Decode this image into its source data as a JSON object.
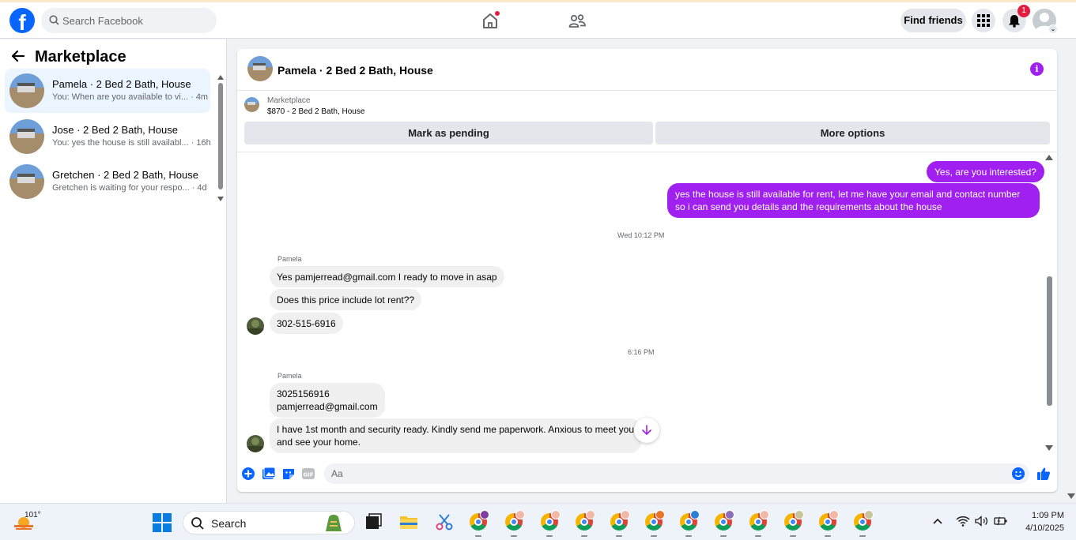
{
  "topbar": {
    "logo": "f",
    "search_placeholder": "Search Facebook",
    "find_friends": "Find friends",
    "notification_count": "1"
  },
  "sidebar": {
    "title": "Marketplace",
    "conversations": [
      {
        "name": "Pamela · 2 Bed 2 Bath, House",
        "preview": "You: When are you available to vi...",
        "time": "· 4m",
        "active": true
      },
      {
        "name": "Jose · 2 Bed 2 Bath, House",
        "preview": "You: yes the house is still availabl...",
        "time": "· 16h",
        "active": false
      },
      {
        "name": "Gretchen · 2 Bed 2 Bath, House",
        "preview": "Gretchen is waiting for your respo...",
        "time": "· 4d",
        "active": false
      }
    ]
  },
  "chat": {
    "title": "Pamela · 2 Bed 2 Bath, House",
    "listing_label": "Marketplace",
    "listing_price": "$870 - 2 Bed 2 Bath, House",
    "mark_pending": "Mark as pending",
    "more_options": "More options",
    "messages": {
      "out1": "Yes, are you interested?",
      "out2_line1": "yes the house is still available for rent, let me have your email  and contact number",
      "out2_line2": "so i can send you details and the requirements about the house",
      "time1": "Wed 10:12 PM",
      "sender1": "Pamela",
      "in1": "Yes pamjerread@gmail.com I ready to move in asap",
      "in2": "Does this price include lot rent??",
      "in3": "302-515-6916",
      "time2": "6:16 PM",
      "sender2": "Pamela",
      "in4_line1": "3025156916",
      "in4_line2": "pamjerread@gmail.com",
      "in5_line1": "I have 1st month and security ready. Kindly send me paperwork. Anxious to meet you",
      "in5_line2": "and see your home."
    },
    "composer_placeholder": "Aa",
    "accent": "#a020f0"
  },
  "taskbar": {
    "weather_temp": "101°",
    "search_label": "Search",
    "time": "1:09 PM",
    "date": "4/10/2025",
    "chrome_badges": [
      "n",
      "",
      "",
      "",
      "",
      "",
      "",
      "",
      "",
      "",
      "",
      ""
    ]
  }
}
